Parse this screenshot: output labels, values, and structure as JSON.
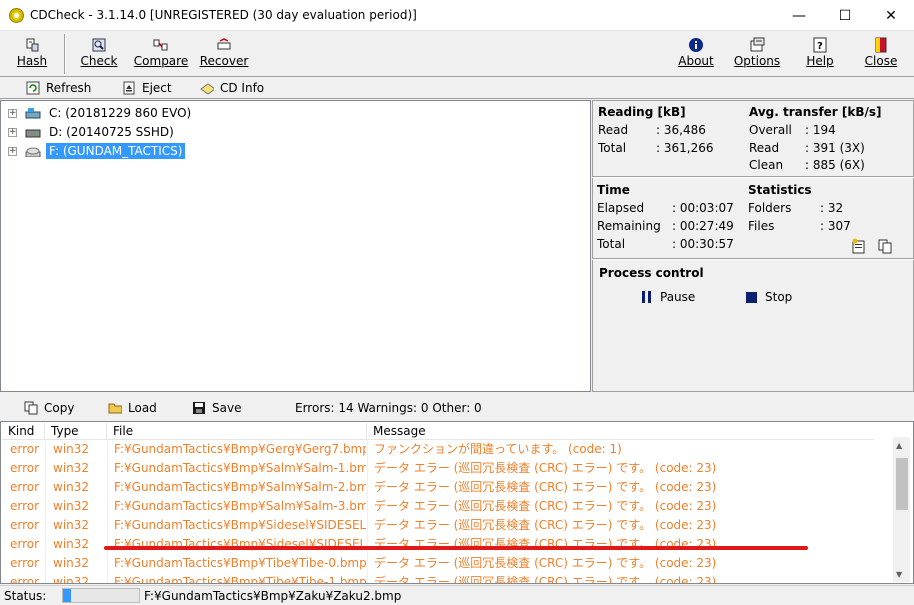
{
  "window": {
    "title": "CDCheck - 3.1.14.0 [UNREGISTERED (30 day evaluation period)]",
    "controls": {
      "minimize": "—",
      "maximize": "☐",
      "close": "✕"
    }
  },
  "toolbar": {
    "hash": "Hash",
    "check": "Check",
    "compare": "Compare",
    "recover": "Recover",
    "about": "About",
    "options": "Options",
    "help": "Help",
    "close": "Close"
  },
  "subtoolbar": {
    "refresh": "Refresh",
    "eject": "Eject",
    "cdinfo": "CD Info"
  },
  "tree": {
    "items": [
      {
        "label": "C: (20181229 860 EVO)",
        "expander": "+"
      },
      {
        "label": "D: (20140725 SSHD)",
        "expander": "+"
      },
      {
        "label": "F: (GUNDAM_TACTICS)",
        "expander": "+",
        "selected": true
      }
    ]
  },
  "stats": {
    "reading": {
      "title": "Reading [kB]",
      "read_label": "Read",
      "read_value": ": 36,486",
      "total_label": "Total",
      "total_value": ": 361,266"
    },
    "transfer": {
      "title": "Avg. transfer [kB/s]",
      "overall_label": "Overall",
      "overall_value": ": 194",
      "read_label": "Read",
      "read_value": ": 391 (3X)",
      "clean_label": "Clean",
      "clean_value": ": 885 (6X)"
    },
    "time": {
      "title": "Time",
      "elapsed_label": "Elapsed",
      "elapsed_value": ": 00:03:07",
      "remaining_label": "Remaining",
      "remaining_value": ": 00:27:49",
      "total_label": "Total",
      "total_value": ": 00:30:57"
    },
    "statistics": {
      "title": "Statistics",
      "folders_label": "Folders",
      "folders_value": ": 32",
      "files_label": "Files",
      "files_value": ": 307"
    },
    "process": {
      "title": "Process control",
      "pause": "Pause",
      "stop": "Stop"
    }
  },
  "logbar": {
    "copy": "Copy",
    "load": "Load",
    "save": "Save",
    "summary": "Errors: 14 Warnings: 0 Other: 0"
  },
  "log": {
    "columns": [
      "Kind",
      "Type",
      "File",
      "Message"
    ],
    "rows": [
      {
        "kind": "error",
        "type": "win32",
        "file": "F:¥GundamTactics¥Bmp¥Gerg¥Gerg7.bmp",
        "message": "ファンクションが間違っています。 (code: 1)"
      },
      {
        "kind": "error",
        "type": "win32",
        "file": "F:¥GundamTactics¥Bmp¥Salm¥Salm-1.bmp",
        "message": "データ エラー (巡回冗長検査 (CRC) エラー) です。 (code: 23)"
      },
      {
        "kind": "error",
        "type": "win32",
        "file": "F:¥GundamTactics¥Bmp¥Salm¥Salm-2.bmp",
        "message": "データ エラー (巡回冗長検査 (CRC) エラー) です。 (code: 23)"
      },
      {
        "kind": "error",
        "type": "win32",
        "file": "F:¥GundamTactics¥Bmp¥Salm¥Salm-3.bmp",
        "message": "データ エラー (巡回冗長検査 (CRC) エラー) です。 (code: 23)"
      },
      {
        "kind": "error",
        "type": "win32",
        "file": "F:¥GundamTactics¥Bmp¥Sidesel¥SIDESEL.BMP",
        "message": "データ エラー (巡回冗長検査 (CRC) エラー) です。 (code: 23)"
      },
      {
        "kind": "error",
        "type": "win32",
        "file": "F:¥GundamTactics¥Bmp¥Sidesel¥SIDESEL.BWH",
        "message": "データ エラー (巡回冗長検査 (CRC) エラー) です。 (code: 23)"
      },
      {
        "kind": "error",
        "type": "win32",
        "file": "F:¥GundamTactics¥Bmp¥Tibe¥Tibe-0.bmp",
        "message": "データ エラー (巡回冗長検査 (CRC) エラー) です。 (code: 23)"
      },
      {
        "kind": "error",
        "type": "win32",
        "file": "F:¥GundamTactics¥Bmp¥Tibe¥Tibe-1.bmp",
        "message": "データ エラー (巡回冗長検査 (CRC) エラー) です。 (code: 23)"
      }
    ]
  },
  "status": {
    "label": "Status:",
    "path": "F:¥GundamTactics¥Bmp¥Zaku¥Zaku2.bmp"
  },
  "colors": {
    "error_text": "#f0802a",
    "selection": "#3399ff",
    "annotation": "#e01818"
  }
}
